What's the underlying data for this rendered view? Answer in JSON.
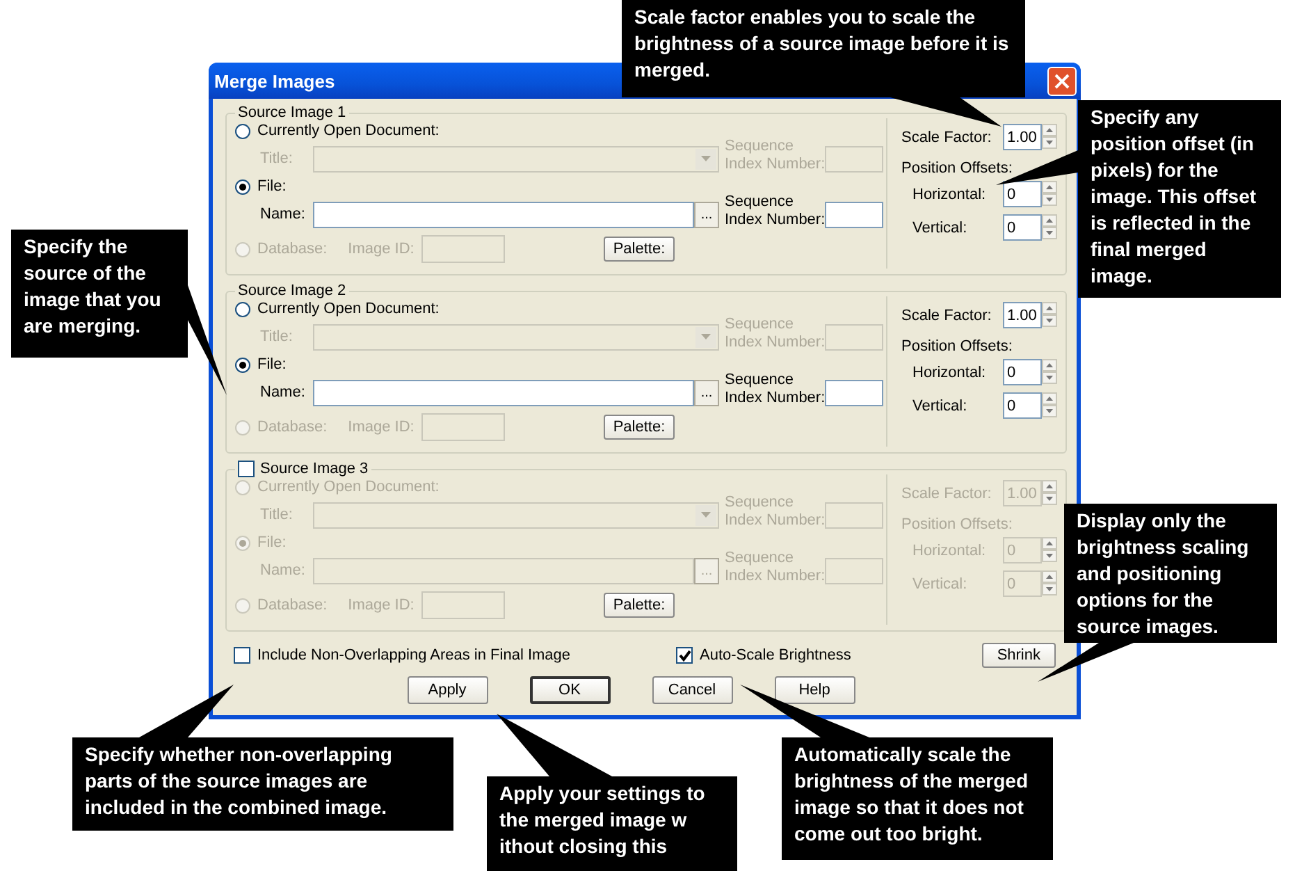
{
  "window": {
    "title": "Merge Images"
  },
  "sources": [
    {
      "title": "Source Image 1",
      "open_document": {
        "label": "Currently Open Document:",
        "selected": false,
        "disabled": false
      },
      "title_label": "Title:",
      "sequence_label_1": "Sequence Index Number:",
      "file": {
        "label": "File:",
        "selected": true,
        "disabled": false
      },
      "name_label": "Name:",
      "browse": "...",
      "sequence_label_2": "Sequence Index Number:",
      "database": {
        "label": "Database:",
        "selected": false,
        "disabled": true
      },
      "image_id_label": "Image ID:",
      "palette": "Palette:",
      "scale_label": "Scale Factor:",
      "scale": "1.00",
      "offsets_label": "Position Offsets:",
      "horizontal_label": "Horizontal:",
      "horizontal": "0",
      "vertical_label": "Vertical:",
      "vertical": "0"
    },
    {
      "title": "Source Image 2",
      "open_document": {
        "label": "Currently Open Document:",
        "selected": false,
        "disabled": false
      },
      "title_label": "Title:",
      "sequence_label_1": "Sequence Index Number:",
      "file": {
        "label": "File:",
        "selected": true,
        "disabled": false
      },
      "name_label": "Name:",
      "browse": "...",
      "sequence_label_2": "Sequence Index Number:",
      "database": {
        "label": "Database:",
        "selected": false,
        "disabled": true
      },
      "image_id_label": "Image ID:",
      "palette": "Palette:",
      "scale_label": "Scale Factor:",
      "scale": "1.00",
      "offsets_label": "Position Offsets:",
      "horizontal_label": "Horizontal:",
      "horizontal": "0",
      "vertical_label": "Vertical:",
      "vertical": "0"
    },
    {
      "title": "Source Image 3",
      "checked": false,
      "open_document": {
        "label": "Currently Open Document:",
        "selected": false,
        "disabled": true
      },
      "title_label": "Title:",
      "sequence_label_1": "Sequence Index Number:",
      "file": {
        "label": "File:",
        "selected": true,
        "disabled": true
      },
      "name_label": "Name:",
      "browse": "...",
      "sequence_label_2": "Sequence Index Number:",
      "database": {
        "label": "Database:",
        "selected": false,
        "disabled": true
      },
      "image_id_label": "Image ID:",
      "palette": "Palette:",
      "scale_label": "Scale Factor:",
      "scale": "1.00",
      "offsets_label": "Position Offsets:",
      "horizontal_label": "Horizontal:",
      "horizontal": "0",
      "vertical_label": "Vertical:",
      "vertical": "0"
    }
  ],
  "options": [
    {
      "label": "Include Non-Overlapping Areas in Final Image",
      "checked": false
    },
    {
      "label": "Auto-Scale Brightness",
      "checked": true
    }
  ],
  "shrink": "Shrink",
  "buttons": [
    {
      "label": "Apply",
      "default": false
    },
    {
      "label": "OK",
      "default": true
    },
    {
      "label": "Cancel",
      "default": false
    },
    {
      "label": "Help",
      "default": false
    }
  ],
  "callouts": [
    "Scale factor enables you  to scale the brightness of a source image before it is merged.",
    "Specify any position offset (in pixels) for the image. This offset is reflected in the final merged image.",
    "Specify the source of the image that you are merging.",
    "Display only the brightness scaling and positioning options for the source images.",
    "Specify whether non-overlapping parts of the source images are included in the combined image.",
    "Apply your settings to the merged image w ithout closing this",
    "Automatically scale the brightness of the merged image so that it does not come out too bright."
  ]
}
